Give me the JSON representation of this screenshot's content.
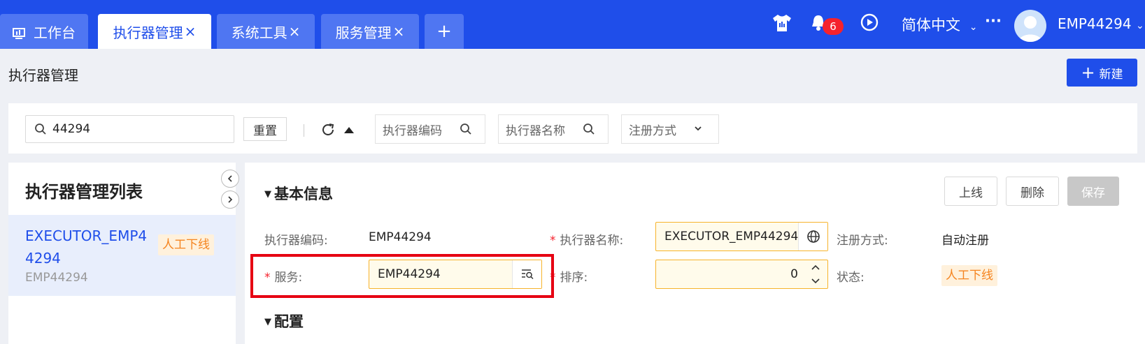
{
  "tabs": [
    {
      "label": "工作台",
      "icon": "dashboard-icon",
      "active": false,
      "closable": false
    },
    {
      "label": "执行器管理",
      "active": true,
      "closable": true
    },
    {
      "label": "系统工具",
      "active": false,
      "closable": true
    },
    {
      "label": "服务管理",
      "active": false,
      "closable": true
    }
  ],
  "tab_close_glyph": "×",
  "add_tab_glyph": "+",
  "topbar": {
    "notification_count": "6",
    "language": "简体中文",
    "more": "···",
    "user": "EMP44294"
  },
  "page": {
    "title": "执行器管理",
    "new_button": "新建"
  },
  "filter": {
    "search_value": "44294",
    "reset_button": "重置",
    "executor_code_placeholder": "执行器编码",
    "executor_name_placeholder": "执行器名称",
    "register_mode_placeholder": "注册方式"
  },
  "list": {
    "title": "执行器管理列表",
    "items": [
      {
        "name": "EXECUTOR_EMP44294",
        "code": "EMP44294",
        "status": "人工下线"
      }
    ]
  },
  "detail": {
    "section_basic": "基本信息",
    "section_config": "配置",
    "actions": {
      "online": "上线",
      "delete": "删除",
      "save": "保存"
    },
    "fields": {
      "executor_code_label": "执行器编码:",
      "executor_code_value": "EMP44294",
      "executor_name_label": "执行器名称:",
      "executor_name_value": "EXECUTOR_EMP44294",
      "register_mode_label": "注册方式:",
      "register_mode_value": "自动注册",
      "service_label": "服务:",
      "service_value": "EMP44294",
      "order_label": "排序:",
      "order_value": "0",
      "status_label": "状态:",
      "status_value": "人工下线"
    }
  },
  "colors": {
    "primary": "#1f4eea",
    "highlight_box": "#e60012",
    "required": "#f5222d",
    "status_tag": "#f5841f"
  }
}
